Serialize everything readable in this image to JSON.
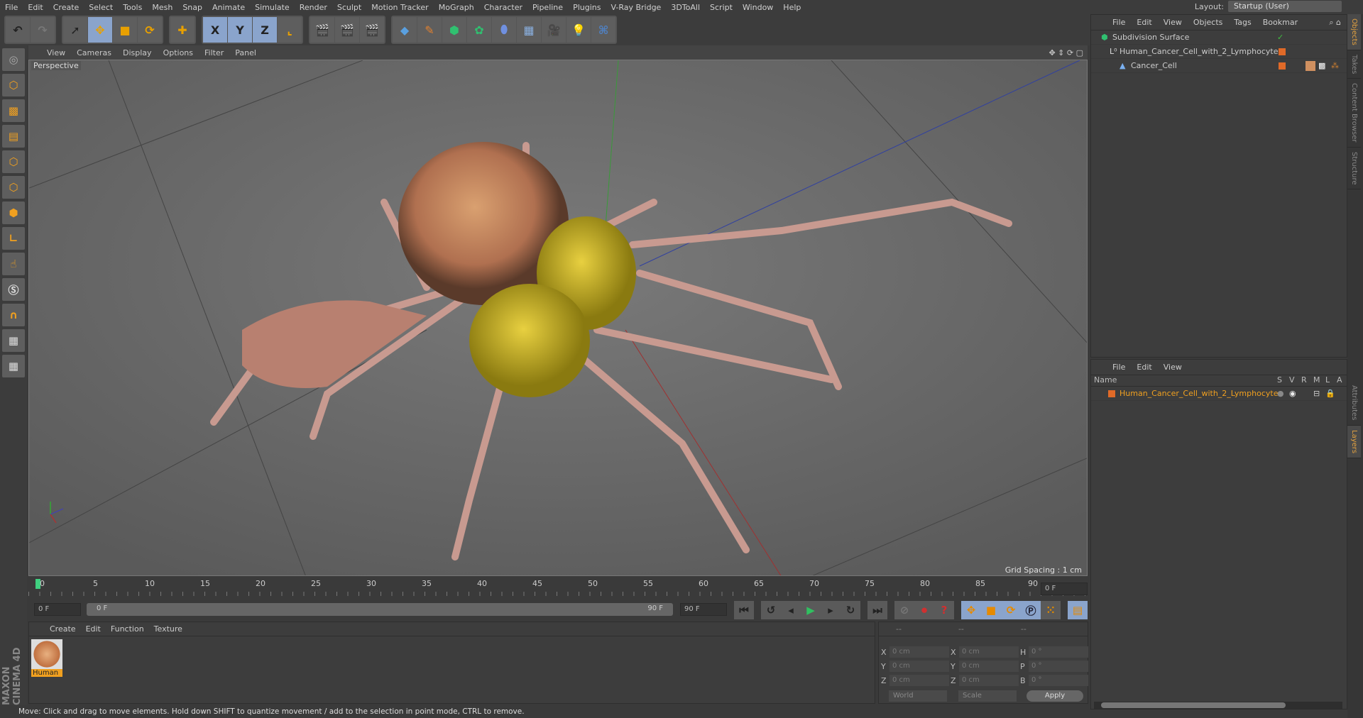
{
  "menu": [
    "File",
    "Edit",
    "Create",
    "Select",
    "Tools",
    "Mesh",
    "Snap",
    "Animate",
    "Simulate",
    "Render",
    "Sculpt",
    "Motion Tracker",
    "MoGraph",
    "Character",
    "Pipeline",
    "Plugins",
    "V-Ray Bridge",
    "3DToAll",
    "Script",
    "Window",
    "Help"
  ],
  "layout": {
    "label": "Layout:",
    "value": "Startup (User)"
  },
  "toolbar": {
    "x": "X",
    "y": "Y",
    "z": "Z"
  },
  "viewport": {
    "menu": [
      "View",
      "Cameras",
      "Display",
      "Options",
      "Filter",
      "Panel"
    ],
    "label": "Perspective",
    "grid_spacing": "Grid Spacing : 1 cm"
  },
  "timeline": {
    "ticks": [
      "0",
      "5",
      "10",
      "15",
      "20",
      "25",
      "30",
      "35",
      "40",
      "45",
      "50",
      "55",
      "60",
      "65",
      "70",
      "75",
      "80",
      "85",
      "90"
    ],
    "current": "0 F",
    "start": "0 F",
    "range_start": "0 F",
    "range_end": "90 F",
    "end": "90 F"
  },
  "material": {
    "menu": [
      "Create",
      "Edit",
      "Function",
      "Texture"
    ],
    "items": [
      {
        "name": "Human"
      }
    ]
  },
  "coords": {
    "headers": [
      "--",
      "--",
      "--"
    ],
    "rows": [
      {
        "a": "X",
        "av": "0 cm",
        "b": "X",
        "bv": "0 cm",
        "c": "H",
        "cv": "0 °"
      },
      {
        "a": "Y",
        "av": "0 cm",
        "b": "Y",
        "bv": "0 cm",
        "c": "P",
        "cv": "0 °"
      },
      {
        "a": "Z",
        "av": "0 cm",
        "b": "Z",
        "bv": "0 cm",
        "c": "B",
        "cv": "0 °"
      }
    ],
    "space": "World",
    "mode": "Scale",
    "apply": "Apply"
  },
  "status": "Move: Click and drag to move elements. Hold down SHIFT to quantize movement / add to the selection in point mode, CTRL to remove.",
  "objects": {
    "menu": [
      "File",
      "Edit",
      "View",
      "Objects",
      "Tags",
      "Bookmar"
    ],
    "items": [
      "Subdivision Surface",
      "Human_Cancer_Cell_with_2_Lymphocyte",
      "Cancer_Cell"
    ]
  },
  "layers": {
    "menu": [
      "File",
      "Edit",
      "View"
    ],
    "columns": [
      "Name",
      "S",
      "V",
      "R",
      "M",
      "L",
      "A"
    ],
    "items": [
      "Human_Cancer_Cell_with_2_Lymphocyte"
    ]
  },
  "side_tabs": [
    "Objects",
    "Takes",
    "Content Browser",
    "Structure",
    "Attributes",
    "Layers"
  ],
  "brand": {
    "logo": "MAXON CINEMA 4D"
  },
  "colors": {
    "accent": "#e0a040",
    "selected_text": "#f0a020"
  }
}
